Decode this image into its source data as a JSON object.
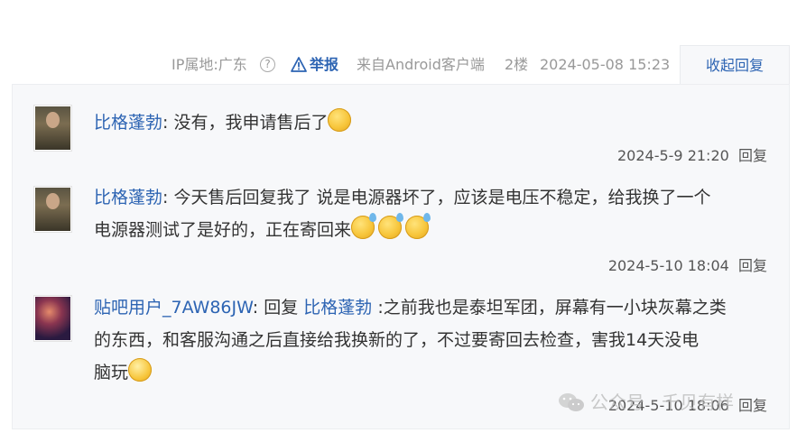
{
  "post_meta": {
    "ip": "IP属地:广东",
    "report": "举报",
    "source": "来自Android客户端",
    "floor": "2楼",
    "time": "2024-05-08 15:23",
    "collapse": "收起回复"
  },
  "replies": [
    {
      "user": "比格蓬勃",
      "text": ": 没有，我申请售后了",
      "time": "2024-5-9 21:20",
      "action": "回复"
    },
    {
      "user": "比格蓬勃",
      "text_line1": ": 今天售后回复我了 说是电源器坏了，应该是电压不稳定，给我换了一个",
      "text_line2": "电源器测试了是好的，正在寄回来",
      "time": "2024-5-10 18:04",
      "action": "回复"
    },
    {
      "user": "贴吧用户_7AW86JW",
      "reply_prefix": ": 回复 ",
      "reply_to": "比格蓬勃",
      "text_line1": " :之前我也是泰坦军团，屏幕有一小块灰幕之类",
      "text_line2": "的东西，和客服沟通之后直接给我换新的了，不过要寄回去检查，害我14天没电",
      "text_line3": "脑玩",
      "time": "2024-5-10 18:06",
      "action": "回复"
    }
  ],
  "watermark": "公众号 · 千贝有样",
  "colors": {
    "link": "#2d64b3",
    "muted": "#999999",
    "panel": "#f7f8fa"
  }
}
